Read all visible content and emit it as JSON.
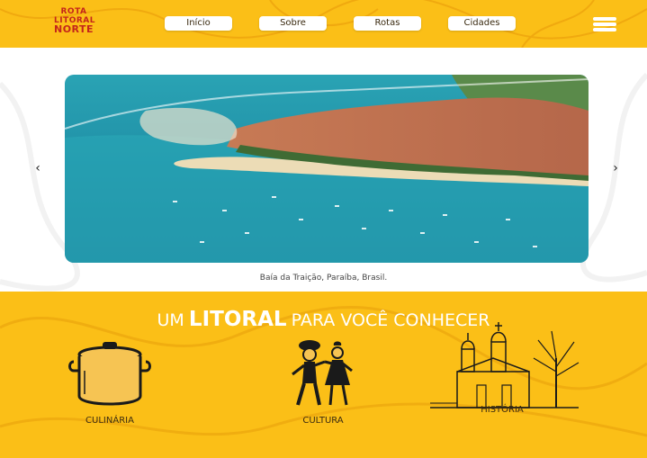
{
  "header": {
    "logo": {
      "line1": "ROTA",
      "line2": "LITORAL",
      "line3": "NORTE"
    },
    "nav": [
      {
        "label": "Início"
      },
      {
        "label": "Sobre"
      },
      {
        "label": "Rotas"
      },
      {
        "label": "Cidades"
      }
    ],
    "menu_icon": "hamburger-icon"
  },
  "carousel": {
    "caption": "Baía da Traição, Paraíba, Brasil.",
    "prev_icon": "chevron-left-icon",
    "next_icon": "chevron-right-icon"
  },
  "section": {
    "headline_pre": "UM",
    "headline_highlight": "LITORAL",
    "headline_post": "PARA VOCÊ CONHECER",
    "cards": [
      {
        "label": "CULINÁRIA",
        "icon": "cooking-pot-icon"
      },
      {
        "label": "CULTURA",
        "icon": "folk-dancers-icon"
      },
      {
        "label": "HISTÓRIA",
        "icon": "church-icon"
      }
    ]
  },
  "colors": {
    "brand_yellow": "#fbbf17",
    "logo_red": "#c4261b",
    "white": "#ffffff"
  }
}
